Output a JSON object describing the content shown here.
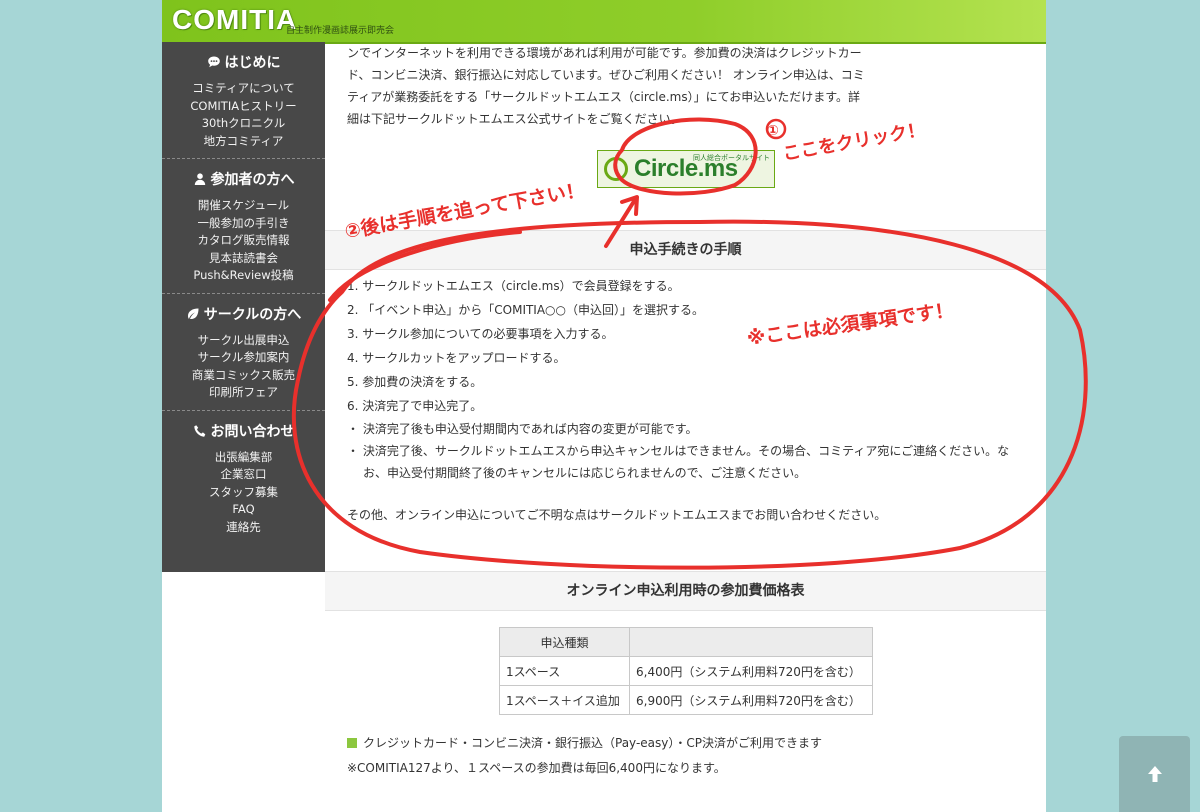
{
  "header": {
    "logo": "COMITIA",
    "tagline": "自主制作漫画誌展示即売会"
  },
  "sidebar": {
    "sections": [
      {
        "heading": "はじめに",
        "icon": "speech-bubble-icon",
        "links": [
          "コミティアについて",
          "COMITIAヒストリー",
          "30thクロニクル",
          "地方コミティア"
        ]
      },
      {
        "heading": "参加者の方へ",
        "icon": "person-icon",
        "links": [
          "開催スケジュール",
          "一般参加の手引き",
          "カタログ販売情報",
          "見本誌読書会",
          "Push&Review投稿"
        ]
      },
      {
        "heading": "サークルの方へ",
        "icon": "leaf-icon",
        "links": [
          "サークル出展申込",
          "サークル参加案内",
          "商業コミックス販売",
          "印刷所フェア"
        ]
      },
      {
        "heading": "お問い合わせ",
        "icon": "phone-icon",
        "links": [
          "出張編集部",
          "企業窓口",
          "スタッフ募集",
          "FAQ",
          "連絡先"
        ]
      }
    ]
  },
  "main": {
    "intro": [
      "ンでインターネットを利用できる環境があれば利用が可能です。参加費の決済はクレジットカー",
      "ド、コンビニ決済、銀行振込に対応しています。ぜひご利用ください！ オンライン申込は、コミ",
      "ティアが業務委託をする「サークルドットエムエス（circle.ms）」にてお申込いただけます。詳",
      "細は下記サークルドットエムエス公式サイトをご覧ください。"
    ],
    "banner": {
      "text": "Circle.ms",
      "sub": "同人総合ポータルサイト"
    },
    "procedure_title": "申込手続きの手順",
    "steps": [
      "1.  サークルドットエムエス（circle.ms）で会員登録をする。",
      "2.  「イベント申込」から「COMITIA○○（申込回）」を選択する。",
      "3.  サークル参加についての必要事項を入力する。",
      "4.  サークルカットをアップロードする。",
      "5.  参加費の決済をする。",
      "6.  決済完了で申込完了。"
    ],
    "notes": [
      "・ 決済完了後も申込受付期間内であれば内容の変更が可能です。",
      "・ 決済完了後、サークルドットエムエスから申込キャンセルはできません。その場合、コミティア宛にご連絡ください。なお、申込受付期間終了後のキャンセルには応じられませんので、ご注意ください。"
    ],
    "closing": "その他、オンライン申込についてご不明な点はサークルドットエムエスまでお問い合わせください。",
    "price_title": "オンライン申込利用時の参加費価格表",
    "price_table": {
      "header": [
        "申込種類",
        ""
      ],
      "rows": [
        [
          "1スペース",
          "6,400円（システム利用料720円を含む）"
        ],
        [
          "1スペース＋イス追加",
          "6,900円（システム利用料720円を含む）"
        ]
      ]
    },
    "payment_note": "クレジットカード・コンビニ決済・銀行振込（Pay-easy）・CP決済がご利用できます",
    "note2": "※COMITIA127より、１スペースの参加費は毎回6,400円になります。"
  },
  "annotations": {
    "click_here": "ここをクリック！",
    "step1_num": "①",
    "follow_steps": "②後は手順を追って下さい！",
    "required": "※ここは必須事項です！"
  },
  "colors": {
    "header_green": "#8fce2a",
    "sidebar": "#484848",
    "background": "#a6d6d6",
    "annotation": "#e8302c"
  },
  "back_to_top_icon": "arrow-up-icon"
}
